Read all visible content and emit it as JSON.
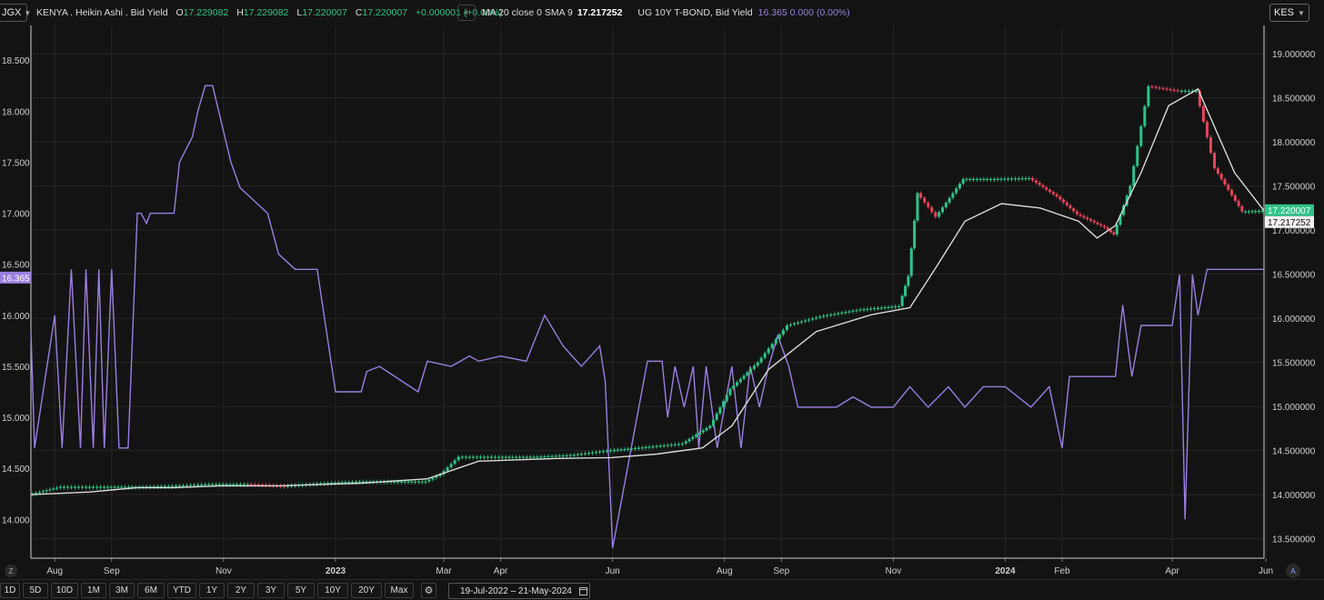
{
  "topbar": {
    "symbol": "JGX",
    "title": "KENYA . Heikin Ashi . Bid Yield",
    "ohlc": {
      "o_label": "O",
      "o": "17.229082",
      "h_label": "H",
      "h": "17.229082",
      "l_label": "L",
      "l": "17.220007",
      "c_label": "C",
      "c": "17.220007",
      "change": "+0.000001 (+0.00%)"
    },
    "ma_label": "MA 20 close 0 SMA 9",
    "ma_value": "17.217252",
    "compare_label": "UG 10Y T-BOND, Bid Yield",
    "compare_value": "16.365 0.000 (0.00%)",
    "currency": "KES"
  },
  "colors": {
    "up": "#2fc389",
    "down": "#e8435a",
    "ma": "#d9d9d9",
    "compare": "#9a7fe0",
    "bg": "#131313",
    "grid": "#262626"
  },
  "bottombar": {
    "ranges": [
      "1D",
      "5D",
      "10D",
      "1M",
      "3M",
      "6M",
      "YTD",
      "1Y",
      "2Y",
      "3Y",
      "5Y",
      "10Y",
      "20Y",
      "Max"
    ],
    "date_range": "19-Jul-2022 – 21-May-2024",
    "zoom_label": "Z",
    "auto_label": "A"
  },
  "chart_data": {
    "type": "line",
    "chart_style": "heikin-ashi candles with moving average and comparison line",
    "x_ticks": [
      "Aug",
      "Sep",
      "Nov",
      "2023",
      "Mar",
      "Apr",
      "Jun",
      "Aug",
      "Sep",
      "Nov",
      "2024",
      "Feb",
      "Apr",
      "Jun"
    ],
    "x_ticks_bold": [
      "2023",
      "2024"
    ],
    "x_range": [
      "2022-07-19",
      "2024-05-21"
    ],
    "y_right": {
      "ticks": [
        "13.500000",
        "14.000000",
        "14.500000",
        "15.000000",
        "15.500000",
        "16.000000",
        "16.500000",
        "17.000000",
        "17.500000",
        "18.000000",
        "18.500000",
        "19.000000"
      ],
      "range": [
        13.28,
        19.32
      ]
    },
    "y_left": {
      "ticks": [
        "14.000",
        "14.500",
        "15.000",
        "15.500",
        "16.000",
        "16.500",
        "17.000",
        "17.500",
        "18.000",
        "18.500"
      ],
      "range": [
        13.62,
        18.84
      ]
    },
    "last_price_label": "17.220007",
    "ma_price_label": "17.217252",
    "compare_price_label": "16.365",
    "series": [
      {
        "name": "KENYA . Heikin Ashi . Bid Yield",
        "axis": "right",
        "x": [
          "2022-07-19",
          "2022-08-05",
          "2022-08-25",
          "2022-09-15",
          "2022-10-05",
          "2022-10-25",
          "2022-11-15",
          "2022-12-05",
          "2022-12-25",
          "2023-01-15",
          "2023-02-05",
          "2023-02-20",
          "2023-02-28",
          "2023-03-10",
          "2023-03-30",
          "2023-04-20",
          "2023-05-10",
          "2023-05-30",
          "2023-06-20",
          "2023-07-10",
          "2023-07-25",
          "2023-08-05",
          "2023-08-20",
          "2023-09-05",
          "2023-09-25",
          "2023-10-15",
          "2023-11-05",
          "2023-11-10",
          "2023-11-15",
          "2023-11-25",
          "2023-12-10",
          "2023-12-25",
          "2024-01-15",
          "2024-01-30",
          "2024-02-10",
          "2024-02-25",
          "2024-03-01",
          "2024-03-10",
          "2024-03-20",
          "2024-04-05",
          "2024-04-15",
          "2024-04-25",
          "2024-05-10",
          "2024-05-21"
        ],
        "values": [
          14.0,
          14.09,
          14.09,
          14.09,
          14.1,
          14.12,
          14.12,
          14.1,
          14.13,
          14.15,
          14.15,
          14.15,
          14.23,
          14.43,
          14.43,
          14.43,
          14.45,
          14.5,
          14.54,
          14.58,
          14.78,
          15.2,
          15.5,
          15.92,
          16.03,
          16.1,
          16.14,
          16.48,
          17.42,
          17.15,
          17.58,
          17.58,
          17.59,
          17.38,
          17.18,
          17.03,
          16.95,
          17.5,
          18.63,
          18.58,
          18.58,
          17.7,
          17.21,
          17.22
        ]
      },
      {
        "name": "MA 20 close 0 SMA 9",
        "axis": "right",
        "x": [
          "2022-07-19",
          "2022-08-20",
          "2022-09-15",
          "2022-10-05",
          "2022-10-30",
          "2022-12-01",
          "2023-01-15",
          "2023-02-20",
          "2023-03-20",
          "2023-04-30",
          "2023-05-31",
          "2023-06-25",
          "2023-07-20",
          "2023-08-05",
          "2023-08-25",
          "2023-09-20",
          "2023-10-20",
          "2023-11-10",
          "2023-11-25",
          "2023-12-10",
          "2023-12-30",
          "2024-01-20",
          "2024-02-10",
          "2024-02-20",
          "2024-03-01",
          "2024-03-15",
          "2024-03-30",
          "2024-04-15",
          "2024-05-05",
          "2024-05-21"
        ],
        "values": [
          14.0,
          14.03,
          14.08,
          14.08,
          14.1,
          14.1,
          14.13,
          14.18,
          14.38,
          14.41,
          14.42,
          14.46,
          14.53,
          14.78,
          15.42,
          15.85,
          16.04,
          16.12,
          16.6,
          17.1,
          17.3,
          17.25,
          17.1,
          16.91,
          17.05,
          17.65,
          18.41,
          18.6,
          17.65,
          17.22
        ]
      },
      {
        "name": "UG 10Y T-BOND, Bid Yield",
        "axis": "left",
        "x": [
          "2022-07-19",
          "2022-07-21",
          "2022-08-01",
          "2022-08-05",
          "2022-08-10",
          "2022-08-15",
          "2022-08-18",
          "2022-08-22",
          "2022-08-25",
          "2022-08-28",
          "2022-09-01",
          "2022-09-05",
          "2022-09-10",
          "2022-09-15",
          "2022-09-17",
          "2022-09-20",
          "2022-09-22",
          "2022-10-05",
          "2022-10-08",
          "2022-10-15",
          "2022-10-18",
          "2022-10-22",
          "2022-10-26",
          "2022-11-05",
          "2022-11-10",
          "2022-11-25",
          "2022-12-01",
          "2022-12-10",
          "2022-12-22",
          "2023-01-01",
          "2023-01-15",
          "2023-01-18",
          "2023-01-25",
          "2023-02-15",
          "2023-02-20",
          "2023-03-05",
          "2023-03-15",
          "2023-03-20",
          "2023-04-01",
          "2023-04-15",
          "2023-04-25",
          "2023-05-05",
          "2023-05-15",
          "2023-05-25",
          "2023-05-28",
          "2023-06-01",
          "2023-06-20",
          "2023-06-28",
          "2023-07-01",
          "2023-07-05",
          "2023-07-10",
          "2023-07-15",
          "2023-07-18",
          "2023-07-22",
          "2023-07-28",
          "2023-08-05",
          "2023-08-10",
          "2023-08-15",
          "2023-08-20",
          "2023-08-25",
          "2023-08-30",
          "2023-09-05",
          "2023-09-10",
          "2023-09-15",
          "2023-10-01",
          "2023-10-10",
          "2023-10-20",
          "2023-11-01",
          "2023-11-10",
          "2023-11-20",
          "2023-12-01",
          "2023-12-10",
          "2023-12-20",
          "2024-01-01",
          "2024-01-15",
          "2024-01-25",
          "2024-02-01",
          "2024-02-05",
          "2024-02-10",
          "2024-02-20",
          "2024-03-01",
          "2024-03-05",
          "2024-03-10",
          "2024-03-15",
          "2024-03-25",
          "2024-04-01",
          "2024-04-05",
          "2024-04-08",
          "2024-04-12",
          "2024-04-15",
          "2024-04-20",
          "2024-04-25",
          "2024-05-01",
          "2024-05-21"
        ],
        "values": [
          15.85,
          14.7,
          16.0,
          14.7,
          16.45,
          14.7,
          16.45,
          14.7,
          16.45,
          14.7,
          16.45,
          14.7,
          14.7,
          17.0,
          17.0,
          16.9,
          17.0,
          17.0,
          17.5,
          17.75,
          18.0,
          18.25,
          18.25,
          17.5,
          17.25,
          17.0,
          16.6,
          16.45,
          16.45,
          15.25,
          15.25,
          15.45,
          15.5,
          15.25,
          15.55,
          15.5,
          15.6,
          15.55,
          15.6,
          15.55,
          16.0,
          15.7,
          15.5,
          15.7,
          15.35,
          13.72,
          15.55,
          15.55,
          15.0,
          15.5,
          15.1,
          15.5,
          14.7,
          15.5,
          14.7,
          15.5,
          14.7,
          15.5,
          15.1,
          15.5,
          15.8,
          15.5,
          15.1,
          15.1,
          15.1,
          15.2,
          15.1,
          15.1,
          15.3,
          15.1,
          15.3,
          15.1,
          15.3,
          15.3,
          15.1,
          15.3,
          14.7,
          15.4,
          15.4,
          15.4,
          15.4,
          16.1,
          15.4,
          15.9,
          15.9,
          15.9,
          16.4,
          14.0,
          16.4,
          16.0,
          16.45,
          16.45,
          16.45,
          16.45
        ]
      }
    ]
  }
}
